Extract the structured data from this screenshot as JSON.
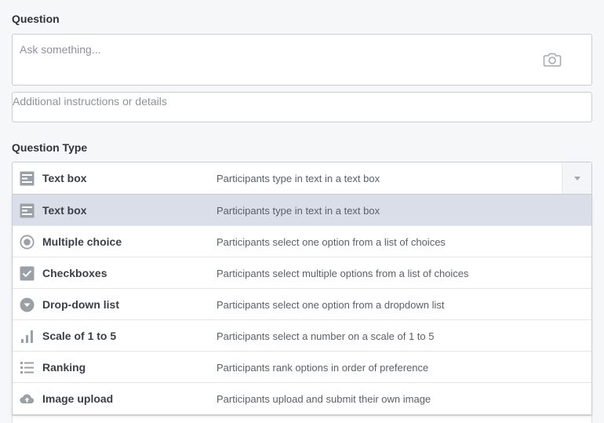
{
  "question": {
    "label": "Question",
    "placeholder": "Ask something...",
    "details_placeholder": "Additional instructions or details"
  },
  "question_type": {
    "label": "Question Type",
    "selected": {
      "name": "Text box",
      "description": "Participants type in text in a text box",
      "icon": "text-box-icon"
    },
    "options": [
      {
        "name": "Text box",
        "description": "Participants type in text in a text box",
        "icon": "text-box-icon"
      },
      {
        "name": "Multiple choice",
        "description": "Participants select one option from a list of choices",
        "icon": "radio-icon"
      },
      {
        "name": "Checkboxes",
        "description": "Participants select multiple options from a list of choices",
        "icon": "checkbox-icon"
      },
      {
        "name": "Drop-down list",
        "description": "Participants select one option from a dropdown list",
        "icon": "dropdown-icon"
      },
      {
        "name": "Scale of 1 to 5",
        "description": "Participants select a number on a scale of 1 to 5",
        "icon": "bar-scale-icon"
      },
      {
        "name": "Ranking",
        "description": "Participants rank options in order of preference",
        "icon": "ranked-list-icon"
      },
      {
        "name": "Image upload",
        "description": "Participants upload and submit their own image",
        "icon": "cloud-upload-icon"
      }
    ]
  },
  "colors": {
    "icon": "#9aa0a6",
    "selected_row": "#d9dee8",
    "border": "#c9ccd1"
  }
}
